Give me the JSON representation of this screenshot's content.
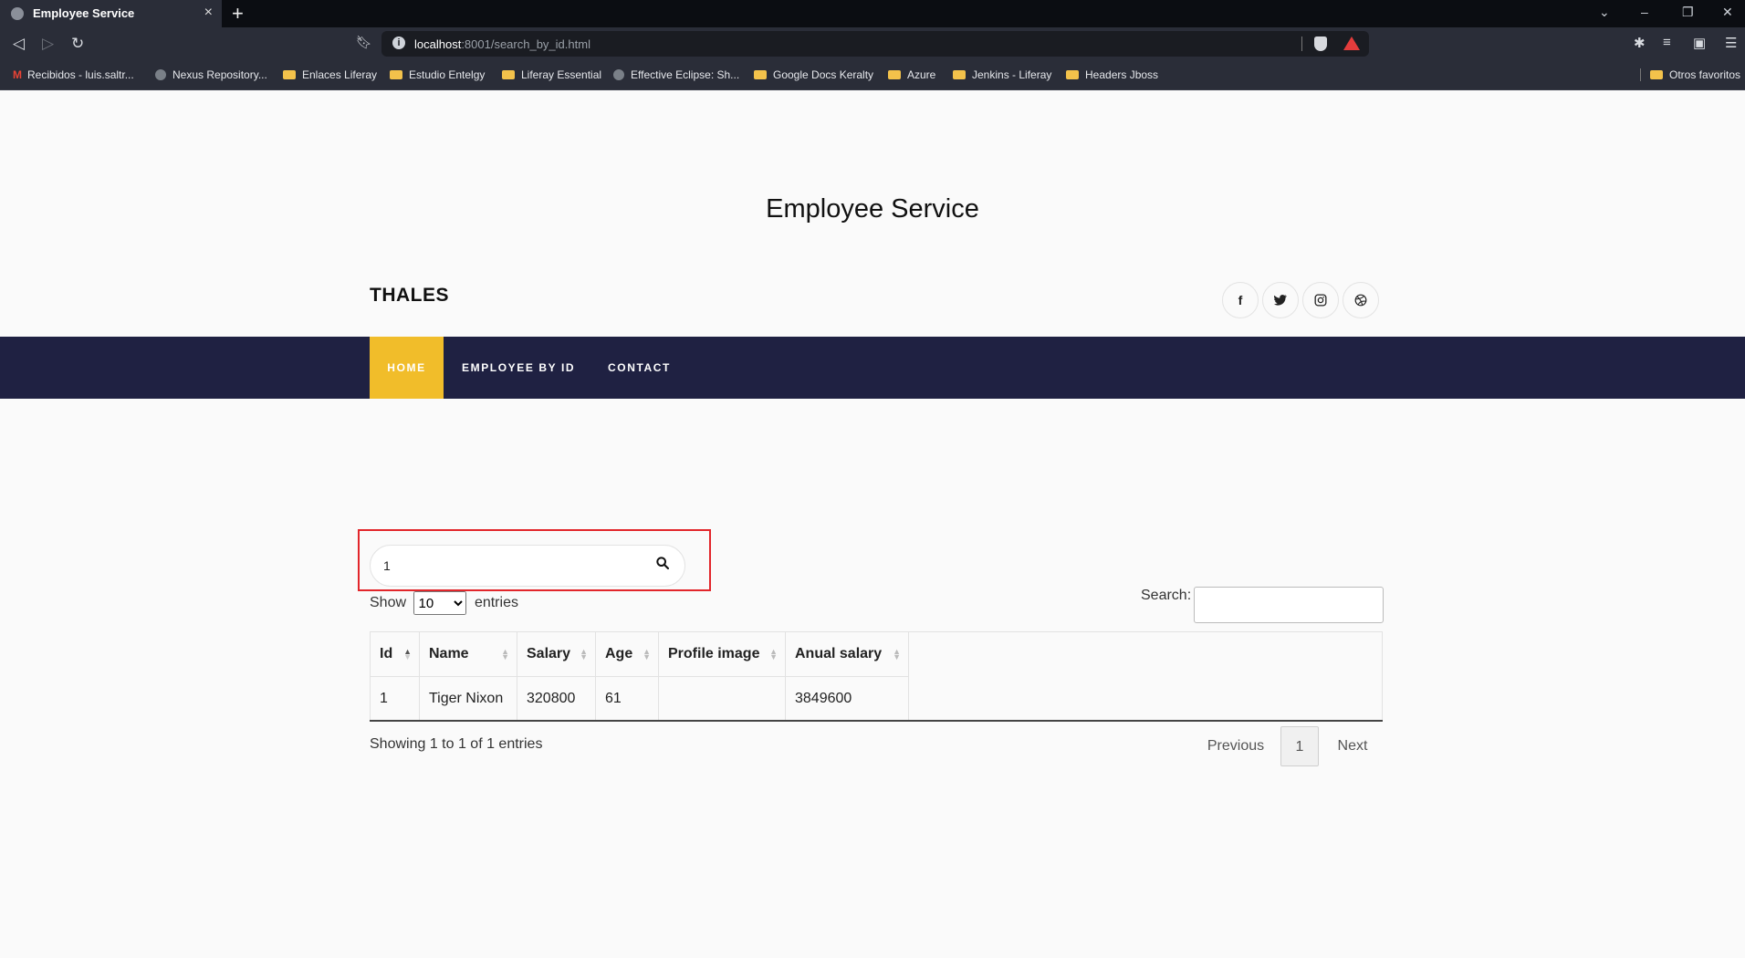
{
  "browser": {
    "tab_title": "Employee Service",
    "tab_close": "×",
    "new_tab": "+",
    "url_host": "localhost",
    "url_path": ":8001/search_by_id.html",
    "bookmarks": [
      {
        "label": "Recibidos - luis.saltr...",
        "icon": "gmail-icon"
      },
      {
        "label": "Nexus Repository...",
        "icon": "globe-icon"
      },
      {
        "label": "Enlaces Liferay",
        "icon": "folder-icon"
      },
      {
        "label": "Estudio Entelgy",
        "icon": "folder-icon"
      },
      {
        "label": "Liferay Essential",
        "icon": "folder-icon"
      },
      {
        "label": "Effective Eclipse: Sh...",
        "icon": "globe-icon"
      },
      {
        "label": "Google Docs Keralty",
        "icon": "folder-icon"
      },
      {
        "label": "Azure",
        "icon": "folder-icon"
      },
      {
        "label": "Jenkins - Liferay",
        "icon": "folder-icon"
      },
      {
        "label": "Headers Jboss",
        "icon": "folder-icon"
      }
    ],
    "other_bookmarks": "Otros favoritos"
  },
  "page": {
    "site_title": "Employee Service",
    "brand": "THALES",
    "social_icons": [
      "facebook-icon",
      "twitter-icon",
      "instagram-icon",
      "dribbble-icon"
    ],
    "nav": {
      "home": "HOME",
      "employee_by_id": "EMPLOYEE BY ID",
      "contact": "CONTACT"
    },
    "search_value": "1",
    "table_controls": {
      "show_label": "Show",
      "entries_label": "entries",
      "page_length": "10",
      "search_label": "Search:"
    },
    "table": {
      "columns": [
        "Id",
        "Name",
        "Salary",
        "Age",
        "Profile image",
        "Anual salary"
      ],
      "rows": [
        [
          "1",
          "Tiger Nixon",
          "320800",
          "61",
          "",
          "3849600"
        ]
      ]
    },
    "info": "Showing 1 to 1 of 1 entries",
    "pagination": {
      "previous": "Previous",
      "page": "1",
      "next": "Next"
    }
  },
  "colors": {
    "nav_bg": "#1f2142",
    "accent": "#f1bd2a",
    "highlight": "#e2262b"
  }
}
